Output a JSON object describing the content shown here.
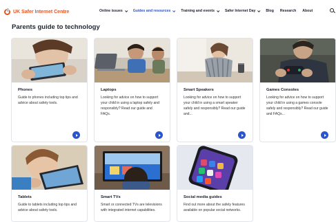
{
  "site": {
    "logo_text": "UK Safer Internet Centre"
  },
  "nav": {
    "items": [
      {
        "label": "Online issues",
        "dropdown": true,
        "active": false
      },
      {
        "label": "Guides and resources",
        "dropdown": true,
        "active": true
      },
      {
        "label": "Training and events",
        "dropdown": true,
        "active": false
      },
      {
        "label": "Safer Internet Day",
        "dropdown": true,
        "active": false
      },
      {
        "label": "Blog",
        "dropdown": false,
        "active": false
      },
      {
        "label": "Research",
        "dropdown": false,
        "active": false
      },
      {
        "label": "About",
        "dropdown": false,
        "active": false
      }
    ],
    "search_icon": "search-icon"
  },
  "page": {
    "title": "Parents guide to technology"
  },
  "cards": [
    {
      "title": "Phones",
      "desc": "Guide to phones including top tips and advice about safety tools.",
      "arrow": true
    },
    {
      "title": "Laptops",
      "desc": "Looking for advice on how to support your child in using a laptop safely and responsibly? Read our guide and FAQs.",
      "arrow": true
    },
    {
      "title": "Smart Speakers",
      "desc": "Looking for advice on how to support your child in using a smart speaker safely and responsibly? Read our guide and...",
      "arrow": true
    },
    {
      "title": "Games Consoles",
      "desc": "Looking for advice on how to support your child in using a games console safely and responsibly? Read our guide and FAQs...",
      "arrow": true
    },
    {
      "title": "Tablets",
      "desc": "Guide to tablets including top tips and advice about safety tools.",
      "arrow": false
    },
    {
      "title": "Smart TVs",
      "desc": "Smart or connected TVs are televisions with integrated internet capabilities.",
      "arrow": false
    },
    {
      "title": "Social media guides",
      "desc": "Find out more about the safety features available on popular social networks.",
      "arrow": false
    }
  ],
  "colors": {
    "brand": "#e8541f",
    "accent": "#2a55d1",
    "active_nav": "#2d4fc4"
  }
}
